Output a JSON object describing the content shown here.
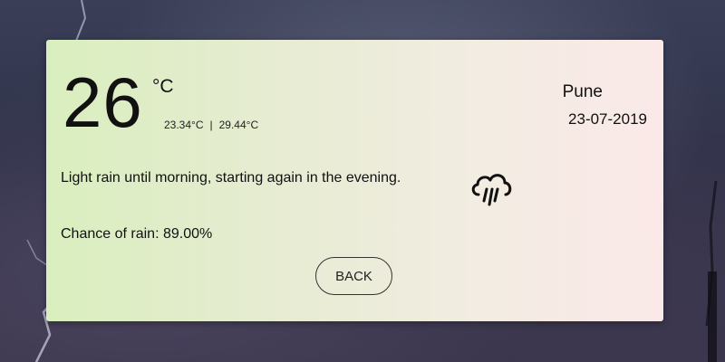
{
  "weather": {
    "temperature": "26",
    "unit": "°C",
    "min_temp": "23.34°C",
    "separator": "|",
    "max_temp": "29.44°C",
    "city": "Pune",
    "date": "23-07-2019",
    "summary": "Light rain until morning, starting again in the evening.",
    "chance_of_rain": "Chance of rain: 89.00%",
    "icon": "rain-cloud-icon"
  },
  "actions": {
    "back_label": "BACK"
  }
}
